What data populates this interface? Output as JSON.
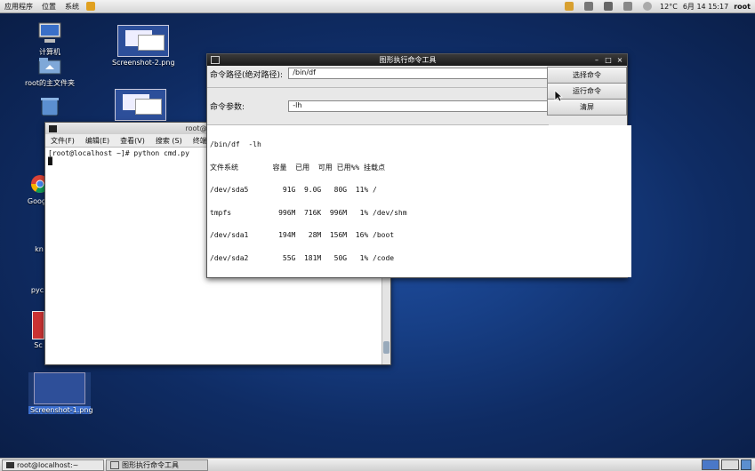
{
  "top_panel": {
    "menus": [
      "应用程序",
      "位置",
      "系统"
    ],
    "temperature": "12°C",
    "datetime": "6月 14 15:17",
    "user": "root"
  },
  "desktop_icons": [
    {
      "label": "计算机"
    },
    {
      "label": "root的主文件夹"
    },
    {
      "label": "Screenshot-2.png"
    },
    {
      "label": "Google"
    },
    {
      "label": "kn"
    },
    {
      "label": "pyc"
    },
    {
      "label": "Sc"
    },
    {
      "label": "Screenshot-1.png"
    }
  ],
  "terminal": {
    "title": "root@loca",
    "menu": [
      "文件(F)",
      "编辑(E)",
      "查看(V)",
      "搜索 (S)",
      "终端(T)"
    ],
    "prompt_line": "[root@localhost ~]# python cmd.py",
    "cursor": "█"
  },
  "tool_window": {
    "title": "图形执行命令工具",
    "path_label": "命令路径(绝对路径):",
    "path_value": "/bin/df",
    "args_label": "命令参数:",
    "args_value": "-lh",
    "buttons": {
      "select": "选择命令",
      "run": "运行命令",
      "clear": "清屏"
    },
    "output": [
      "/bin/df  -lh",
      "文件系统        容量  已用  可用 已用%% 挂载点",
      "/dev/sda5        91G  9.0G   80G  11% /",
      "tmpfs           996M  716K  996M   1% /dev/shm",
      "/dev/sda1       194M   28M  156M  16% /boot",
      "/dev/sda2        55G  181M   50G   1% /code"
    ]
  },
  "taskbar": {
    "items": [
      {
        "label": "root@localhost:~"
      },
      {
        "label": "图形执行命令工具"
      }
    ]
  }
}
